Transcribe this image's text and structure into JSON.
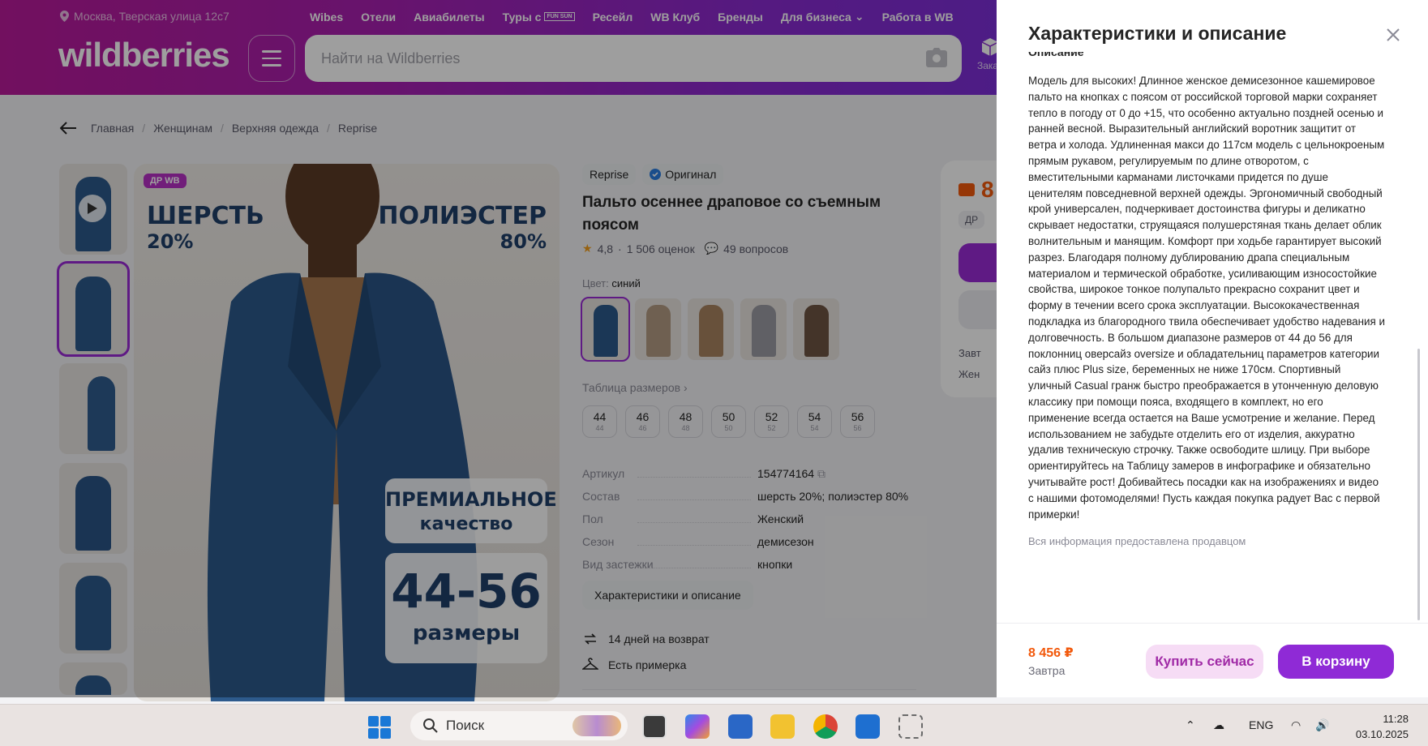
{
  "header": {
    "location": "Москва, Тверская улица 12с7",
    "nav": [
      "Wibes",
      "Отели",
      "Авиабилеты",
      "Туры с",
      "Ресейл",
      "WB Клуб",
      "Бренды",
      "Для бизнеса",
      "Работа в WB"
    ],
    "tours_badge": "FUN SUN",
    "logo": "wildberries",
    "search_placeholder": "Найти на Wildberries",
    "orders_label": "Заказ"
  },
  "breadcrumbs": [
    "Главная",
    "Женщинам",
    "Верхняя одежда",
    "Reprise"
  ],
  "gallery": {
    "badge": "ДР WB",
    "text_wool": "ШЕРСТЬ",
    "text_wool_pct": "20%",
    "text_poly": "ПОЛИЭСТЕР",
    "text_poly_pct": "80%",
    "text_premium": "ПРЕМИАЛЬНОЕ",
    "text_quality": "качество",
    "text_sizes": "44-56",
    "text_sizes_word": "размеры",
    "thumb_count": 6
  },
  "product": {
    "brand": "Reprise",
    "original_label": "Оригинал",
    "title": "Пальто осеннее драповое со съемным поясом",
    "rating": "4,8",
    "reviews": "1 506 оценок",
    "questions": "49 вопросов",
    "color_label": "Цвет:",
    "color_value": "синий",
    "size_table_label": "Таблица размеров",
    "sizes": [
      {
        "ru": "44",
        "alt": "44"
      },
      {
        "ru": "46",
        "alt": "46"
      },
      {
        "ru": "48",
        "alt": "48"
      },
      {
        "ru": "50",
        "alt": "50"
      },
      {
        "ru": "52",
        "alt": "52"
      },
      {
        "ru": "54",
        "alt": "54"
      },
      {
        "ru": "56",
        "alt": "56"
      }
    ],
    "specs": [
      {
        "k": "Артикул",
        "v": "154774164"
      },
      {
        "k": "Состав",
        "v": "шерсть 20%; полиэстер 80%"
      },
      {
        "k": "Пол",
        "v": "Женский"
      },
      {
        "k": "Сезон",
        "v": "демисезон"
      },
      {
        "k": "Вид застежки",
        "v": "кнопки"
      }
    ],
    "char_button": "Характеристики и описание",
    "return_label": "14 дней на возврат",
    "fitting_label": "Есть примерка"
  },
  "price_card": {
    "price_partial": "8",
    "dr_partial": "ДР",
    "delivery_partial": "Завт",
    "gender_partial": "Жен"
  },
  "drawer": {
    "title": "Характеристики и описание",
    "section": "Описание",
    "description": "Модель для высоких! Длинное женское демисезонное кашемировое пальто на кнопках с поясом от российской торговой марки сохраняет тепло в погоду от 0 до +15, что особенно актуально поздней осенью и ранней весной. Выразительный английский воротник защитит от ветра и холода. Удлиненная макси до 117см модель с цельнокроеным прямым рукавом, регулируемым по длине отворотом, с вместительными карманами листочками придется по душе ценителям повседневной верхней одежды. Эргономичный свободный крой универсален, подчеркивает достоинства фигуры и деликатно скрывает недостатки, струящаяся полушерстяная ткань делает облик волнительным и манящим. Комфорт при ходьбе гарантирует высокий разрез. Благодаря полному дублированию драпа специальным материалом и термической обработке, усиливающим износостойкие свойства, широкое тонкое полупальто прекрасно сохранит цвет и форму в течении всего срока эксплуатации. Высококачественная подкладка из благородного твила обеспечивает удобство надевания и долговечность. В большом диапазоне размеров от 44 до 56 для поклонниц оверсайз oversize и обладательниц параметров категории сайз плюс Plus size, беременных не ниже 170см. Спортивный уличный Casual гранж быстро преображается в утонченную деловую классику при помощи пояса, входящего в комплект, но его применение всегда остается на Ваше усмотрение и желание. Перед использованием не забудьте отделить его от изделия, аккуратно удалив техническую строчку. Также освободите шлицу. При выборе ориентируйтесь на Таблицу замеров в инфографике и обязательно учитывайте рост! Добивайтесь посадки как на изображениях и видео с нашими фотомоделями! Пусть каждая покупка радует Вас с первой примерки!",
    "note": "Вся информация предоставлена продавцом",
    "price": "8 456 ₽",
    "delivery": "Завтра",
    "buy_now": "Купить сейчас",
    "add_to_cart": "В корзину"
  },
  "taskbar": {
    "search_label": "Поиск",
    "lang": "ENG",
    "time": "11:28",
    "date": "03.10.2025"
  },
  "colors": {
    "brand_purple": "#9a2ad6",
    "price_orange": "#f2590c",
    "coat_blue": "#2d5a8c"
  }
}
